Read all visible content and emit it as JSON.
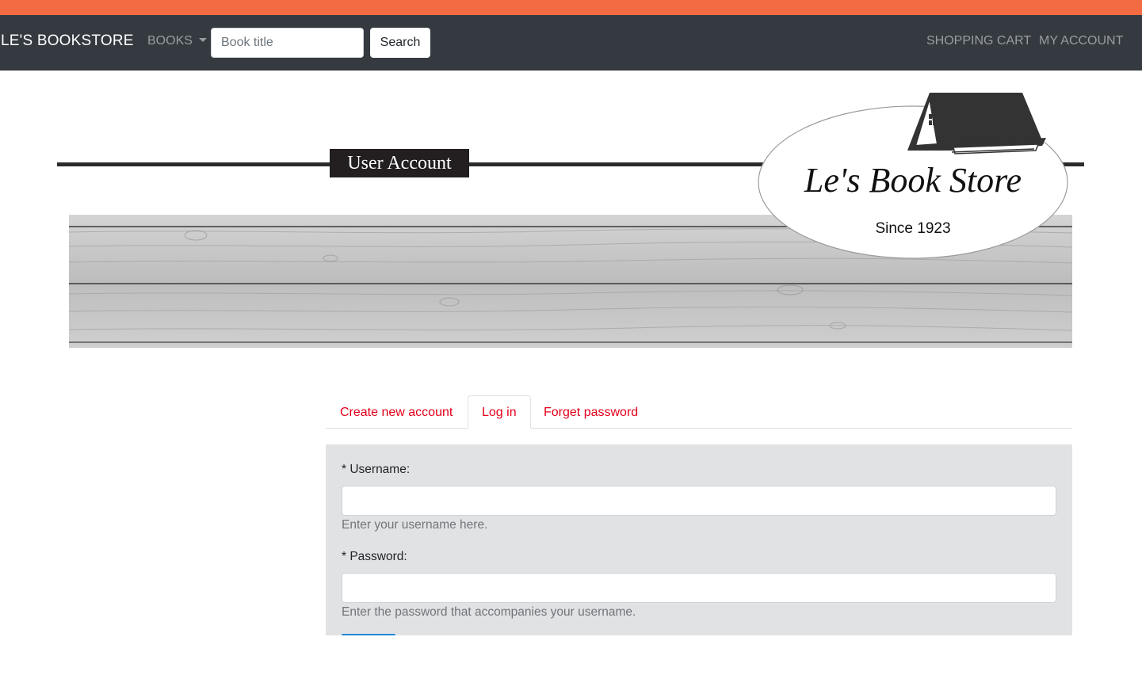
{
  "colors": {
    "accent_strip": "#f26b43",
    "navbar_bg": "#343a40",
    "tab_link": "#e2001a",
    "form_bg": "#e1e2e4"
  },
  "navbar": {
    "brand": "LE'S BOOKSTORE",
    "books_label": "BOOKS",
    "search_placeholder": "Book title",
    "search_button": "Search",
    "cart_label": "SHOPPING CART",
    "account_label": "MY ACCOUNT"
  },
  "header": {
    "title": "User Account"
  },
  "logo": {
    "name": "Le's Book Store",
    "tagline": "Since 1923"
  },
  "tabs": [
    {
      "label": "Create new account",
      "active": false
    },
    {
      "label": "Log in",
      "active": true
    },
    {
      "label": "Forget password",
      "active": false
    }
  ],
  "form": {
    "username_label": "* Username:",
    "username_value": "",
    "username_help": "Enter your username here.",
    "password_label": "* Password:",
    "password_value": "",
    "password_help": "Enter the password that accompanies your username."
  }
}
